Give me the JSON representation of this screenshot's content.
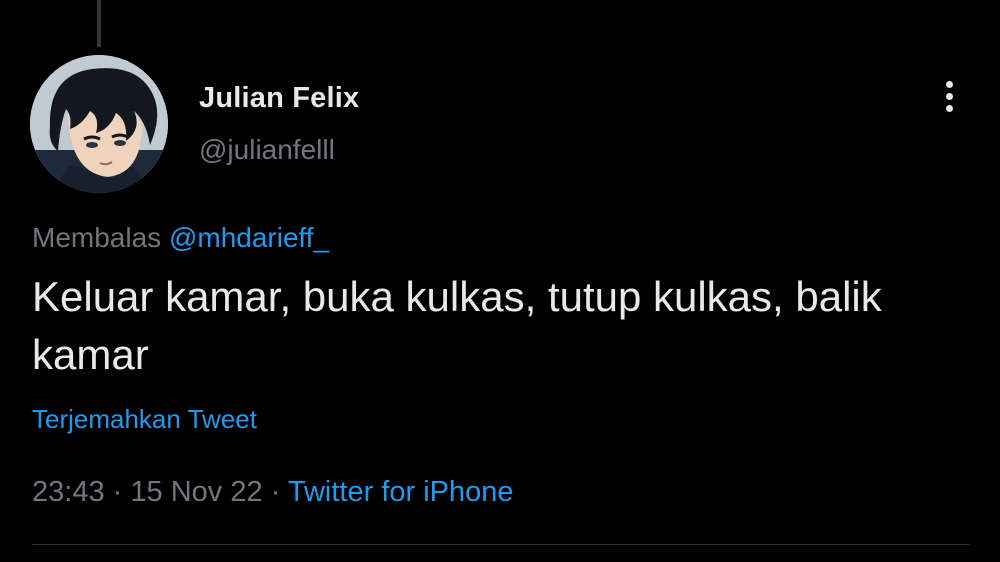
{
  "author": {
    "name": "Julian Felix",
    "handle": "@julianfelll"
  },
  "reply": {
    "prefix": "Membalas",
    "mention": "@mhdarieff_"
  },
  "tweet": {
    "text": "Keluar kamar, buka kulkas, tutup kulkas, balik kamar",
    "translate_label": "Terjemahkan Tweet"
  },
  "meta": {
    "time": "23:43",
    "separator": "·",
    "date": "15 Nov 22",
    "source": "Twitter for iPhone"
  },
  "icons": {
    "more": "more-vertical-icon"
  },
  "colors": {
    "background": "#000000",
    "primary_text": "#e7e9ea",
    "secondary_text": "#71767b",
    "accent": "#1d9bf0"
  }
}
